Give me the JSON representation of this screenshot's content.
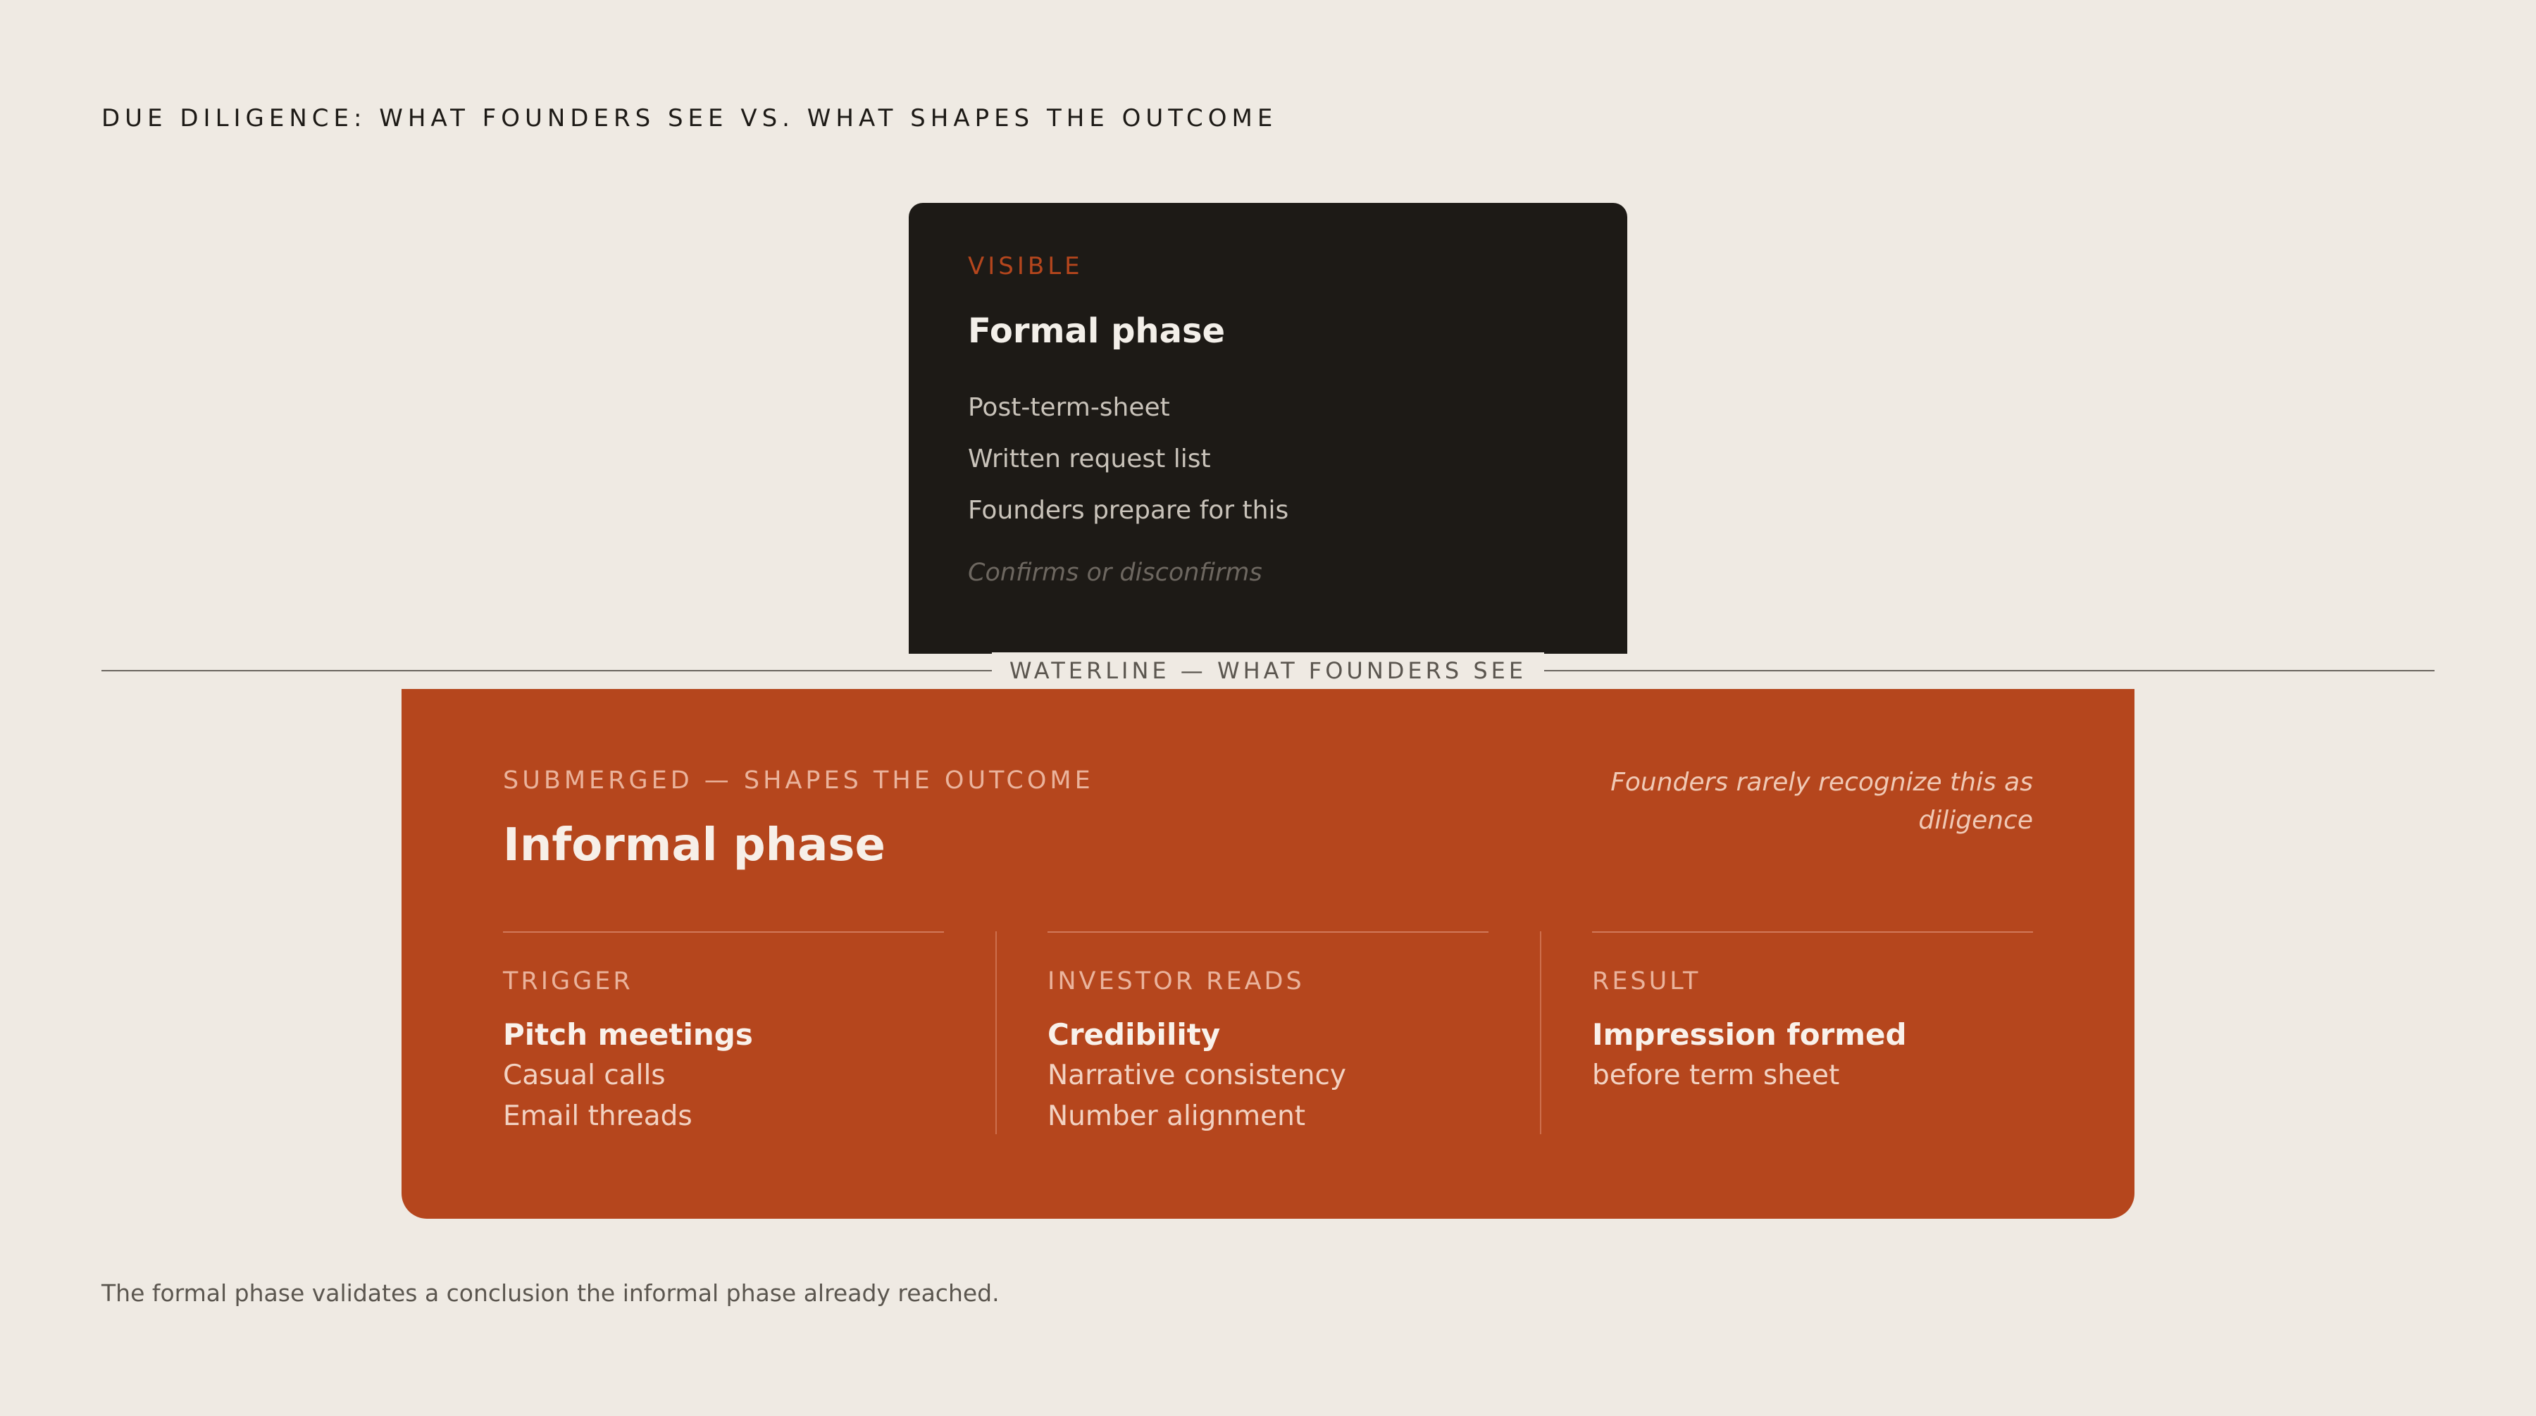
{
  "page_title": "DUE DILIGENCE: WHAT FOUNDERS SEE VS. WHAT SHAPES THE OUTCOME",
  "visible": {
    "label": "VISIBLE",
    "title": "Formal phase",
    "items": [
      "Post-term-sheet",
      "Written request list",
      "Founders prepare for this"
    ],
    "note": "Confirms or disconfirms"
  },
  "waterline": {
    "label": "WATERLINE — WHAT FOUNDERS SEE"
  },
  "submerged": {
    "label": "SUBMERGED — SHAPES THE OUTCOME",
    "title": "Informal phase",
    "note": "Founders rarely recognize this as diligence",
    "columns": [
      {
        "label": "TRIGGER",
        "head": "Pitch meetings",
        "items": [
          "Casual calls",
          "Email threads"
        ]
      },
      {
        "label": "INVESTOR READS",
        "head": "Credibility",
        "items": [
          "Narrative consistency",
          "Number alignment"
        ]
      },
      {
        "label": "RESULT",
        "head": "Impression formed",
        "items": [
          "before term sheet"
        ]
      }
    ]
  },
  "footer": {
    "note": "The formal phase validates a conclusion the informal phase already reached."
  },
  "colors": {
    "background": "#efeae3",
    "dark_card": "#1d1a16",
    "accent": "#b5461d"
  }
}
